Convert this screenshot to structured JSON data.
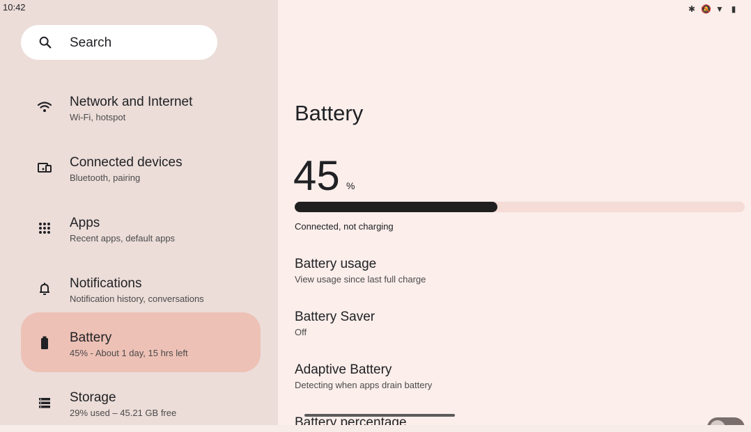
{
  "status_bar": {
    "time": "10:42",
    "icons": [
      "bluetooth-icon",
      "mute-icon",
      "wifi-icon",
      "battery-icon"
    ]
  },
  "sidebar": {
    "search": {
      "label": "Search",
      "icon": "search-icon"
    },
    "items": [
      {
        "title": "Network and Internet",
        "subtitle": "Wi-Fi, hotspot",
        "icon": "wifi-icon"
      },
      {
        "title": "Connected devices",
        "subtitle": "Bluetooth, pairing",
        "icon": "devices-icon"
      },
      {
        "title": "Apps",
        "subtitle": "Recent apps, default apps",
        "icon": "apps-grid-icon"
      },
      {
        "title": "Notifications",
        "subtitle": "Notification history, conversations",
        "icon": "bell-icon"
      },
      {
        "title": "Battery",
        "subtitle": "45% - About 1 day, 15 hrs left",
        "icon": "battery-icon",
        "selected": true
      },
      {
        "title": "Storage",
        "subtitle": "29% used – 45.21 GB free",
        "icon": "storage-icon"
      }
    ]
  },
  "main": {
    "title": "Battery",
    "level_value": "45",
    "level_unit": "%",
    "level_fraction": 0.45,
    "charge_status": "Connected, not charging",
    "prefs": [
      {
        "title": "Battery usage",
        "subtitle": "View usage since last full charge"
      },
      {
        "title": "Battery Saver",
        "subtitle": "Off"
      },
      {
        "title": "Adaptive Battery",
        "subtitle": "Detecting when apps drain battery"
      },
      {
        "title": "Battery percentage",
        "subtitle": ""
      }
    ]
  },
  "colors": {
    "sidebar_bg": "#ecddd9",
    "main_bg": "#fbeeeb",
    "selected_bg": "#eec1b6",
    "bar_fill": "#1f1f1f",
    "bar_track": "#f5dcd6"
  }
}
